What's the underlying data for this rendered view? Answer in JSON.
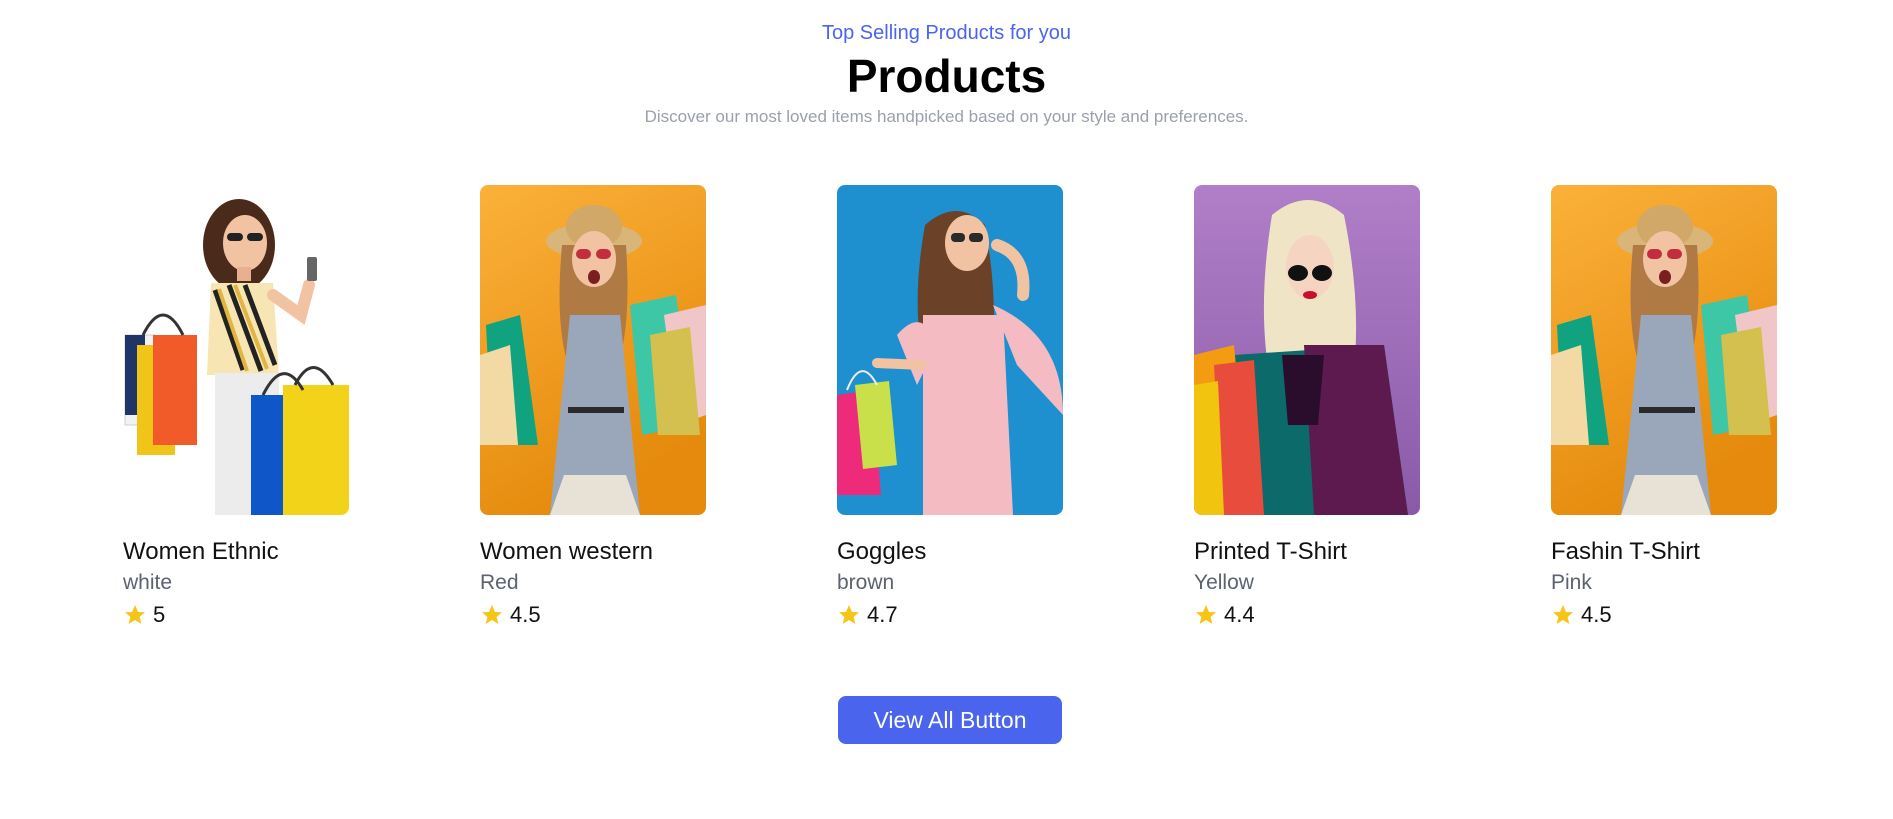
{
  "header": {
    "tagline": "Top Selling Products for you",
    "title": "Products",
    "subtitle": "Discover our most loved items handpicked based on your style and preferences."
  },
  "products": [
    {
      "name": "Women Ethnic",
      "color": "white",
      "rating": "5",
      "image_bg": "#ffffff"
    },
    {
      "name": "Women western",
      "color": "Red",
      "rating": "4.5",
      "image_bg": "#f5a623"
    },
    {
      "name": "Goggles",
      "color": "brown",
      "rating": "4.7",
      "image_bg": "#1e90cf"
    },
    {
      "name": "Printed T-Shirt",
      "color": "Yellow",
      "rating": "4.4",
      "image_bg": "#a97fc4"
    },
    {
      "name": "Fashin T-Shirt",
      "color": "Pink",
      "rating": "4.5",
      "image_bg": "#f5a623"
    }
  ],
  "cta": {
    "label": "View All Button"
  },
  "colors": {
    "accent": "#4a64ee",
    "star": "#f5c518"
  },
  "icons": {
    "rating": "star-icon"
  }
}
